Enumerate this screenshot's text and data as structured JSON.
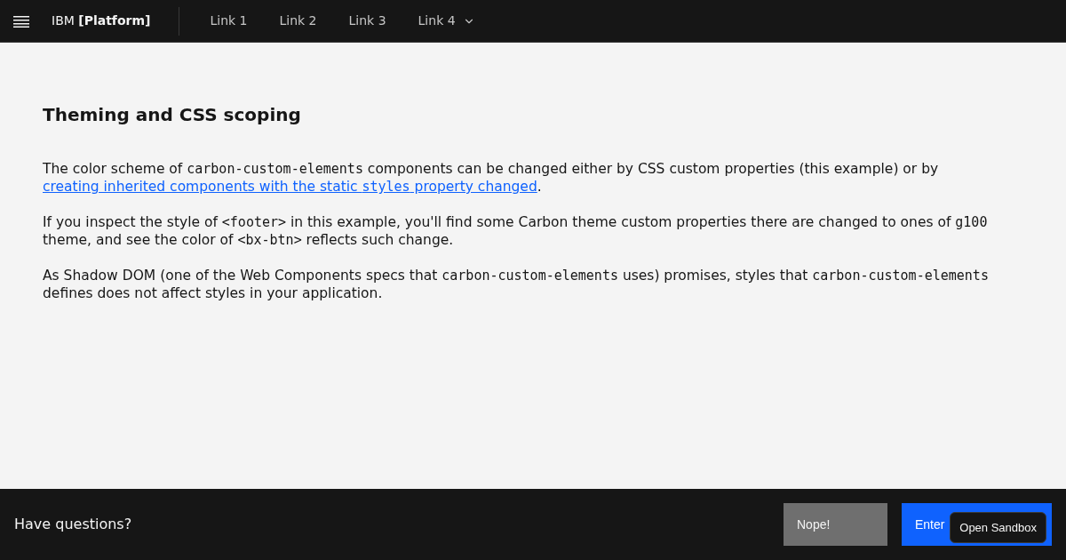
{
  "header": {
    "brand_prefix": "IBM",
    "brand_name": "[Platform]",
    "links": [
      {
        "label": "Link 1",
        "kind": "link"
      },
      {
        "label": "Link 2",
        "kind": "link"
      },
      {
        "label": "Link 3",
        "kind": "link"
      },
      {
        "label": "Link 4",
        "kind": "menu"
      }
    ]
  },
  "content": {
    "title": "Theming and CSS scoping",
    "paragraphs": [
      [
        {
          "kind": "text",
          "text": "The color scheme of "
        },
        {
          "kind": "code",
          "text": "carbon-custom-elements"
        },
        {
          "kind": "text",
          "text": " components can be changed either by CSS custom properties (this example) or by "
        },
        {
          "kind": "link",
          "parts": [
            {
              "kind": "text",
              "text": "creating inherited components with the static "
            },
            {
              "kind": "code",
              "text": "styles"
            },
            {
              "kind": "text",
              "text": " property changed"
            }
          ]
        },
        {
          "kind": "text",
          "text": "."
        }
      ],
      [
        {
          "kind": "text",
          "text": "If you inspect the style of "
        },
        {
          "kind": "code",
          "text": "<footer>"
        },
        {
          "kind": "text",
          "text": " in this example, you'll find some Carbon theme custom properties there are changed to ones of "
        },
        {
          "kind": "code",
          "text": "g100"
        },
        {
          "kind": "text",
          "text": " theme, and see the color of "
        },
        {
          "kind": "code",
          "text": "<bx-btn>"
        },
        {
          "kind": "text",
          "text": " reflects such change."
        }
      ],
      [
        {
          "kind": "text",
          "text": "As Shadow DOM (one of the Web Components specs that "
        },
        {
          "kind": "code",
          "text": "carbon-custom-elements"
        },
        {
          "kind": "text",
          "text": " uses) promises, styles that "
        },
        {
          "kind": "code",
          "text": "carbon-custom-elements"
        },
        {
          "kind": "text",
          "text": " defines does not affect styles in your application."
        }
      ]
    ]
  },
  "footer": {
    "question": "Have questions?",
    "buttons": [
      {
        "label": "Nope!",
        "kind": "secondary"
      },
      {
        "label": "Enter",
        "kind": "primary"
      }
    ]
  },
  "overlay": {
    "label": "Open Sandbox"
  }
}
